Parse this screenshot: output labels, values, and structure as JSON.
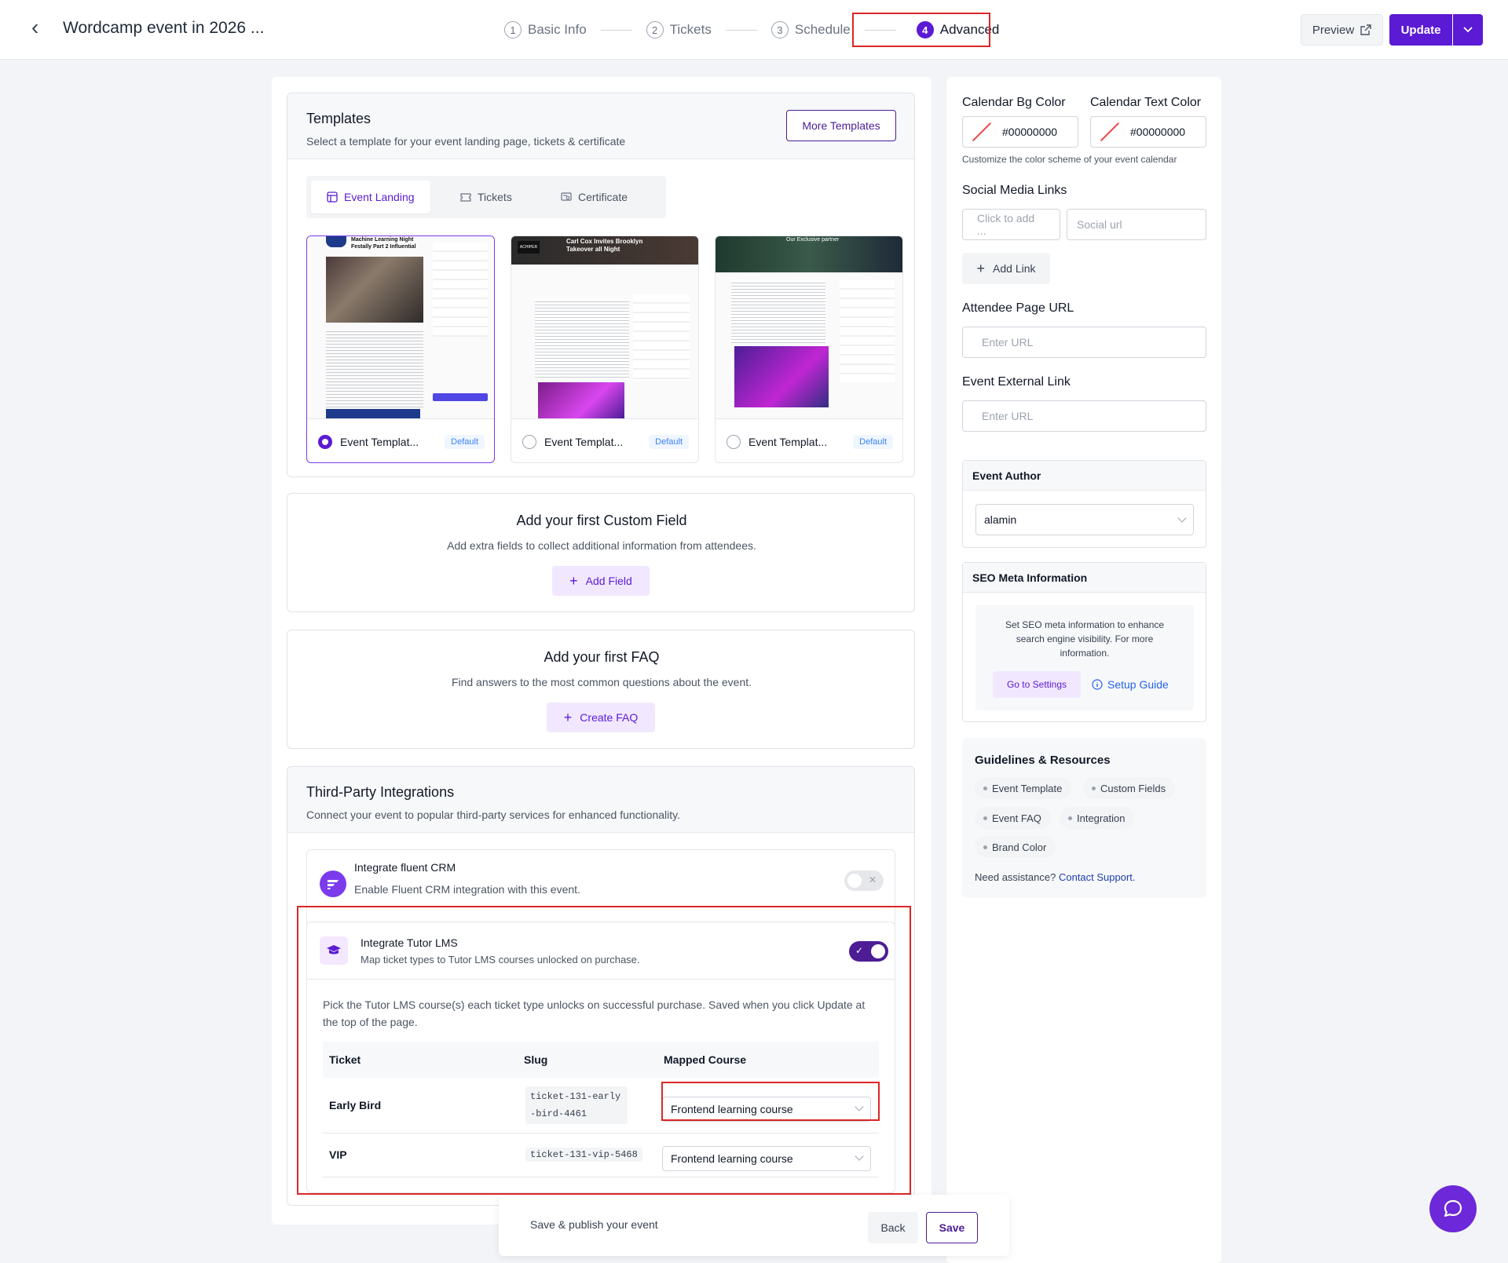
{
  "header": {
    "event_title": "Wordcamp event in 2026 ...",
    "steps": [
      {
        "num": "1",
        "label": "Basic Info"
      },
      {
        "num": "2",
        "label": "Tickets"
      },
      {
        "num": "3",
        "label": "Schedule"
      },
      {
        "num": "4",
        "label": "Advanced"
      }
    ],
    "preview_label": "Preview",
    "update_label": "Update"
  },
  "templates": {
    "title": "Templates",
    "subtitle": "Select a template for your event landing page, tickets & certificate",
    "more_label": "More Templates",
    "tabs": [
      "Event Landing",
      "Tickets",
      "Certificate"
    ],
    "items": [
      {
        "name": "Event Templat...",
        "badge": "Default",
        "selected": true,
        "thumb_title": "Machine Learning Night Festally Part 2 Influential"
      },
      {
        "name": "Event Templat...",
        "badge": "Default",
        "selected": false,
        "thumb_title": "Carl Cox Invites Brooklyn Takeover all Night"
      },
      {
        "name": "Event Templat...",
        "badge": "Default",
        "selected": false,
        "thumb_title": "Our Exclusive partner"
      }
    ]
  },
  "custom_field": {
    "title": "Add your first Custom Field",
    "subtitle": "Add extra fields to collect additional information from attendees.",
    "button": "Add Field"
  },
  "faq": {
    "title": "Add your first FAQ",
    "subtitle": "Find answers to the most common questions about the event.",
    "button": "Create FAQ"
  },
  "integrations": {
    "title": "Third-Party Integrations",
    "subtitle": "Connect your event to popular third-party services for enhanced functionality.",
    "fluent": {
      "title": "Integrate fluent CRM",
      "subtitle": "Enable Fluent CRM integration with this event.",
      "enabled": false
    },
    "tutor": {
      "title": "Integrate Tutor LMS",
      "subtitle": "Map ticket types to Tutor LMS courses unlocked on purchase.",
      "enabled": true,
      "description": "Pick the Tutor LMS course(s) each ticket type unlocks on successful purchase. Saved when you click Update at the top of the page.",
      "columns": [
        "Ticket",
        "Slug",
        "Mapped Course"
      ],
      "rows": [
        {
          "ticket": "Early Bird",
          "slug": "ticket-131-early-bird-4461",
          "course": "Frontend learning course"
        },
        {
          "ticket": "VIP",
          "slug": "ticket-131-vip-5468",
          "course": "Frontend learning course"
        }
      ]
    }
  },
  "sidebar": {
    "calendar_bg_label": "Calendar Bg Color",
    "calendar_bg_value": "#00000000",
    "calendar_text_label": "Calendar Text Color",
    "calendar_text_value": "#00000000",
    "calendar_help": "Customize the color scheme of your event calendar",
    "social_label": "Social Media Links",
    "social_placeholder_name": "Click to add ...",
    "social_placeholder_url": "Social url",
    "add_link": "Add Link",
    "attendee_label": "Attendee Page URL",
    "attendee_placeholder": "Enter URL",
    "external_label": "Event External Link",
    "external_placeholder": "Enter URL",
    "author_title": "Event Author",
    "author_value": "alamin",
    "seo_title": "SEO Meta Information",
    "seo_text": "Set SEO meta information to enhance search engine visibility. For more information.",
    "seo_settings": "Go to Settings",
    "seo_guide": "Setup Guide",
    "guidelines_title": "Guidelines & Resources",
    "chips": [
      "Event Template",
      "Custom Fields",
      "Event FAQ",
      "Integration",
      "Brand Color"
    ],
    "assist_text": "Need assistance?",
    "assist_link": "Contact Support."
  },
  "savebar": {
    "text": "Save & publish your event",
    "back": "Back",
    "save": "Save"
  },
  "colors": {
    "accent": "#5b1ad4",
    "highlight": "#dc2626"
  }
}
